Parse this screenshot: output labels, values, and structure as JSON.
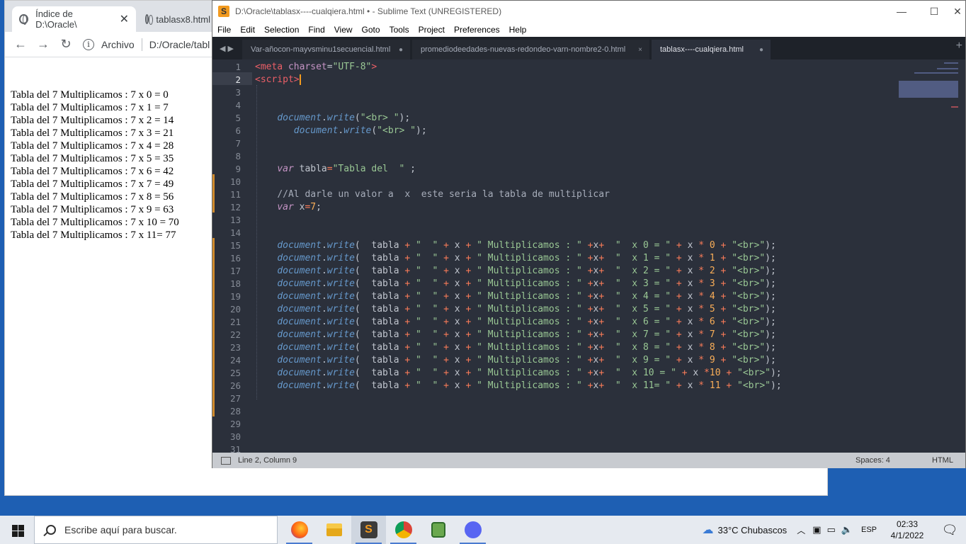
{
  "browser": {
    "tabs": [
      {
        "label": "Índice de D:\\Oracle\\"
      },
      {
        "label": "tablasx8.html"
      }
    ],
    "address": {
      "label": "Archivo",
      "path": "D:/Oracle/tabl"
    },
    "content_lines": [
      "Tabla del 7 Multiplicamos : 7 x 0 = 0",
      "Tabla del 7 Multiplicamos : 7 x 1 = 7",
      "Tabla del 7 Multiplicamos : 7 x 2 = 14",
      "Tabla del 7 Multiplicamos : 7 x 3 = 21",
      "Tabla del 7 Multiplicamos : 7 x 4 = 28",
      "Tabla del 7 Multiplicamos : 7 x 5 = 35",
      "Tabla del 7 Multiplicamos : 7 x 6 = 42",
      "Tabla del 7 Multiplicamos : 7 x 7 = 49",
      "Tabla del 7 Multiplicamos : 7 x 8 = 56",
      "Tabla del 7 Multiplicamos : 7 x 9 = 63",
      "Tabla del 7 Multiplicamos : 7 x 10 = 70",
      "Tabla del 7 Multiplicamos : 7 x 11= 77"
    ]
  },
  "sublime": {
    "title": "D:\\Oracle\\tablasx----cualqiera.html • - Sublime Text (UNREGISTERED)",
    "menu": [
      "File",
      "Edit",
      "Selection",
      "Find",
      "View",
      "Goto",
      "Tools",
      "Project",
      "Preferences",
      "Help"
    ],
    "tabs": [
      {
        "label": "Var-añocon-mayvsminu1secuencial.html",
        "mark": "●"
      },
      {
        "label": "promediodeedades-nuevas-redondeo-varn-nombre2-0.html",
        "mark": "×"
      },
      {
        "label": "tablasx----cualqiera.html",
        "mark": "●"
      }
    ],
    "line_numbers": [
      "1",
      "2",
      "3",
      "4",
      "5",
      "6",
      "7",
      "8",
      "9",
      "10",
      "11",
      "12",
      "13",
      "14",
      "15",
      "16",
      "17",
      "18",
      "19",
      "20",
      "21",
      "22",
      "23",
      "24",
      "25",
      "26",
      "27",
      "28",
      "29",
      "30",
      "31"
    ],
    "status": {
      "position": "Line 2, Column 9",
      "spaces": "Spaces: 4",
      "syntax": "HTML"
    }
  },
  "taskbar": {
    "search_placeholder": "Escribe aquí para buscar.",
    "weather": "33°C  Chubascos",
    "language": "ESP",
    "time": "02:33",
    "date": "4/1/2022",
    "apps": [
      "firefox-icon",
      "file-explorer-icon",
      "sublime-text-icon",
      "chrome-icon",
      "notepad-icon",
      "discord-icon"
    ]
  },
  "colors": {
    "accent": "#f29a1f",
    "editor_bg": "#2b303b",
    "modified_marker": "#d08a2c"
  }
}
